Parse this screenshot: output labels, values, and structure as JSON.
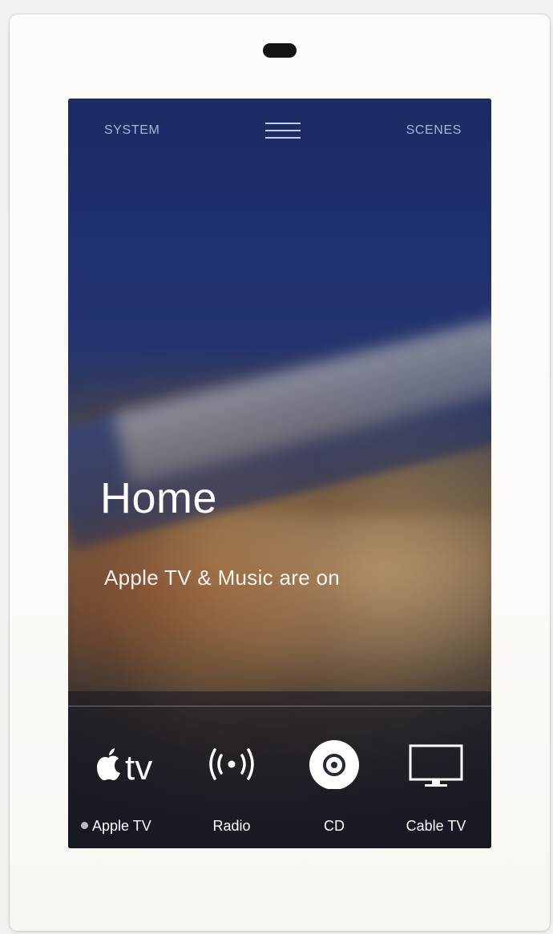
{
  "header": {
    "system_label": "SYSTEM",
    "scenes_label": "SCENES"
  },
  "room": {
    "title": "Home",
    "status": "Apple TV & Music are on"
  },
  "sources": [
    {
      "label": "Apple TV",
      "icon": "apple-tv-icon",
      "active": true
    },
    {
      "label": "Radio",
      "icon": "radio-broadcast-icon",
      "active": false
    },
    {
      "label": "CD",
      "icon": "cd-icon",
      "active": false
    },
    {
      "label": "Cable TV",
      "icon": "tv-monitor-icon",
      "active": false
    }
  ],
  "apple_tv_logo_text": "tv",
  "colors": {
    "bezel": "#fbfaf6",
    "screen_sky": "#1f3070",
    "text": "#ffffff",
    "active_dot": "#b8bcc8"
  }
}
